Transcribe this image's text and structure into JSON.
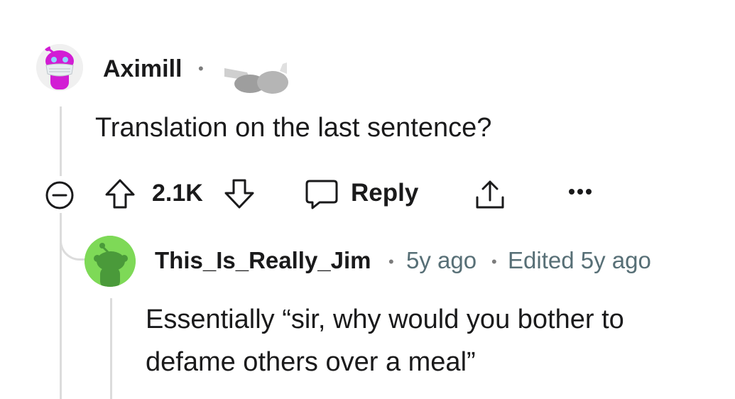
{
  "comment": {
    "author": "Aximill",
    "text": "Translation on the last sentence?",
    "score": "2.1K",
    "reply_label": "Reply"
  },
  "reply": {
    "author": "This_Is_Really_Jim",
    "age": "5y ago",
    "edited": "Edited 5y ago",
    "text_line1": "Essentially “sir, why would you bother to",
    "text_line2": "defame others over a meal”"
  },
  "colors": {
    "thread_line": "#dcdcdc",
    "meta_text": "#576f76",
    "avatar1_bg": "#f2f2f2",
    "avatar1_body": "#d21dd4",
    "avatar2_bg": "#7ed957",
    "avatar2_body": "#4a9a3a"
  },
  "icons": [
    "collapse-icon",
    "upvote-icon",
    "downvote-icon",
    "comment-bubble-icon",
    "share-icon",
    "more-options-icon"
  ]
}
